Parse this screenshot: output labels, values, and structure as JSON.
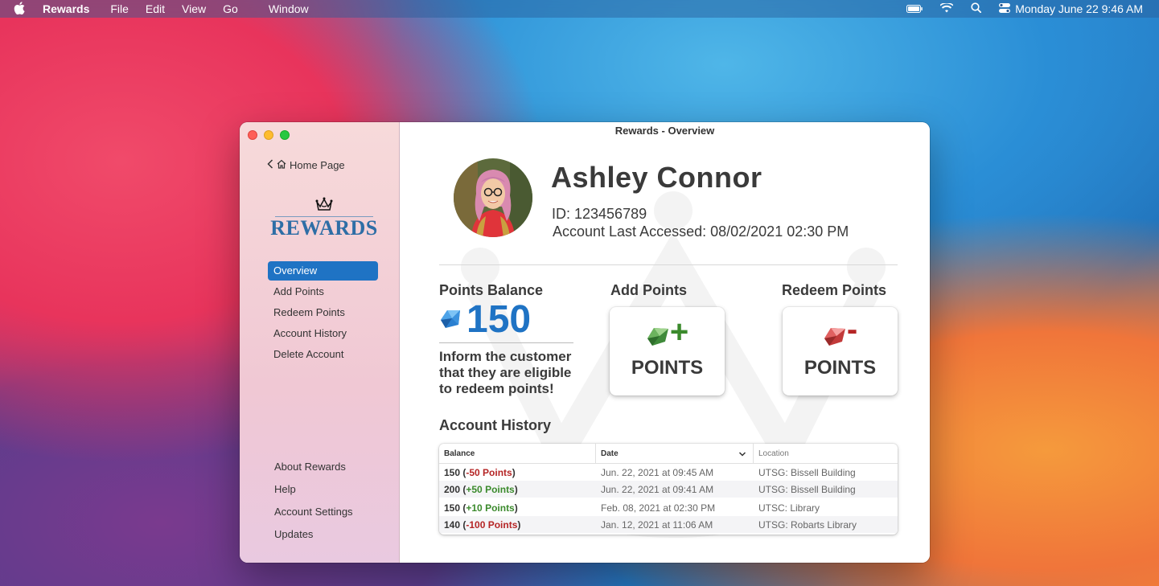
{
  "menubar": {
    "app_name": "Rewards",
    "items": [
      "File",
      "Edit",
      "View",
      "Go",
      "Window"
    ],
    "datetime": "Monday June 22  9:46 AM"
  },
  "window": {
    "title": "Rewards - Overview"
  },
  "sidebar": {
    "back_label": "Home Page",
    "logo_text": "REWARDS",
    "nav": [
      {
        "label": "Overview",
        "active": true
      },
      {
        "label": "Add Points",
        "active": false
      },
      {
        "label": "Redeem Points",
        "active": false
      },
      {
        "label": "Account History",
        "active": false
      },
      {
        "label": "Delete Account",
        "active": false
      }
    ],
    "bottom": [
      "About Rewards",
      "Help",
      "Account Settings",
      "Updates"
    ]
  },
  "profile": {
    "name": "Ashley Connor",
    "id_line": "ID: 123456789",
    "access_line": "Account Last Accessed: 08/02/2021 02:30 PM"
  },
  "balance": {
    "label": "Points Balance",
    "value": "150",
    "message": "Inform the customer that they are eligible to redeem points!"
  },
  "add_points": {
    "label": "Add Points",
    "button_text": "POINTS"
  },
  "redeem_points": {
    "label": "Redeem Points",
    "button_text": "POINTS"
  },
  "history": {
    "label": "Account History",
    "columns": [
      "Balance",
      "Date",
      "Location"
    ],
    "rows": [
      {
        "balance": "150",
        "change": "-50 Points",
        "sign": "neg",
        "date": "Jun. 22, 2021 at 09:45 AM",
        "location": "UTSG: Bissell Building"
      },
      {
        "balance": "200",
        "change": "+50 Points",
        "sign": "pos",
        "date": "Jun. 22, 2021 at 09:41 AM",
        "location": "UTSG: Bissell Building"
      },
      {
        "balance": "150",
        "change": "+10 Points",
        "sign": "pos",
        "date": "Feb. 08, 2021 at 02:30 PM",
        "location": "UTSC: Library"
      },
      {
        "balance": "140",
        "change": "-100 Points",
        "sign": "neg",
        "date": "Jan.  12, 2021 at 11:06 AM",
        "location": "UTSG: Robarts Library"
      }
    ]
  },
  "colors": {
    "accent": "#1f73c4",
    "positive": "#3b8a2c",
    "negative": "#b52525"
  }
}
